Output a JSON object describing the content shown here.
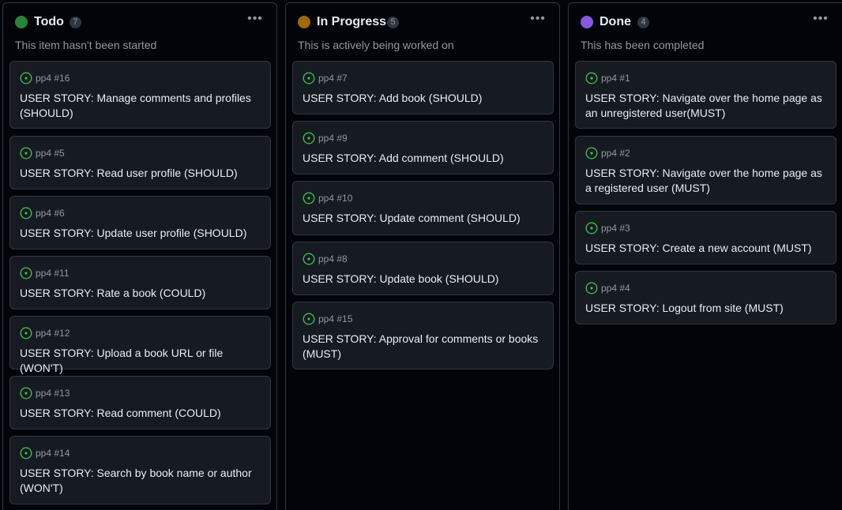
{
  "colors": {
    "todo": "#238636",
    "in_progress": "#9e6a03",
    "done": "#8957e5",
    "issue_open": "#3fb950"
  },
  "columns": [
    {
      "title": "Todo",
      "count": "7",
      "description": "This item hasn't been started",
      "items": [
        {
          "ref": "pp4 #16",
          "title": "USER STORY: Manage comments and profiles (SHOULD)"
        },
        {
          "ref": "pp4 #5",
          "title": "USER STORY: Read user profile (SHOULD)"
        },
        {
          "ref": "pp4 #6",
          "title": "USER STORY: Update user profile (SHOULD)"
        },
        {
          "ref": "pp4 #11",
          "title": "USER STORY: Rate a book (COULD)"
        },
        {
          "ref": "pp4 #12",
          "title": "USER STORY: Upload a book URL or file (WON'T)"
        },
        {
          "ref": "pp4 #13",
          "title": "USER STORY: Read comment (COULD)"
        },
        {
          "ref": "pp4 #14",
          "title": "USER STORY: Search by book name or author (WON'T)"
        }
      ]
    },
    {
      "title": "In Progress",
      "count": "5",
      "description": "This is actively being worked on",
      "items": [
        {
          "ref": "pp4 #7",
          "title": "USER STORY: Add book (SHOULD)"
        },
        {
          "ref": "pp4 #9",
          "title": "USER STORY: Add comment (SHOULD)"
        },
        {
          "ref": "pp4 #10",
          "title": "USER STORY: Update comment (SHOULD)"
        },
        {
          "ref": "pp4 #8",
          "title": "USER STORY: Update book (SHOULD)"
        },
        {
          "ref": "pp4 #15",
          "title": "USER STORY: Approval for comments or books (MUST)"
        }
      ]
    },
    {
      "title": "Done",
      "count": "4",
      "description": "This has been completed",
      "items": [
        {
          "ref": "pp4 #1",
          "title": "USER STORY: Navigate over the home page as an unregistered user(MUST)"
        },
        {
          "ref": "pp4 #2",
          "title": "USER STORY: Navigate over the home page as a registered user (MUST)"
        },
        {
          "ref": "pp4 #3",
          "title": "USER STORY: Create a new account (MUST)"
        },
        {
          "ref": "pp4 #4",
          "title": "USER STORY: Logout from site (MUST)"
        }
      ]
    }
  ]
}
